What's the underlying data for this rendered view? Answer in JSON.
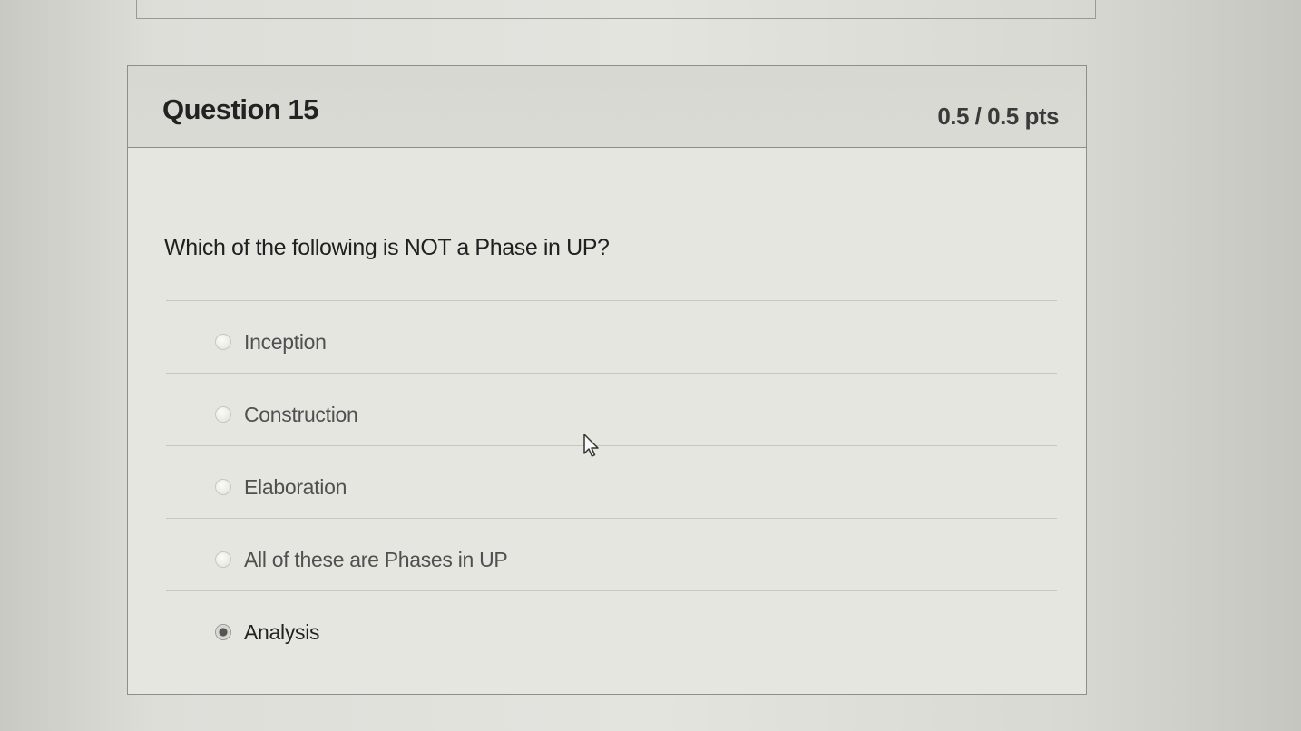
{
  "question": {
    "title": "Question 15",
    "points": "0.5 / 0.5 pts",
    "text": "Which of the following is NOT a Phase in UP?"
  },
  "answers": [
    {
      "label": "Inception",
      "selected": false
    },
    {
      "label": "Construction",
      "selected": false
    },
    {
      "label": "Elaboration",
      "selected": false
    },
    {
      "label": "All of these are Phases in UP",
      "selected": false
    },
    {
      "label": "Analysis",
      "selected": true
    }
  ],
  "icons": {
    "radio_unselected": "radio-unselected-icon",
    "radio_selected": "radio-selected-icon",
    "cursor": "mouse-pointer-icon"
  }
}
